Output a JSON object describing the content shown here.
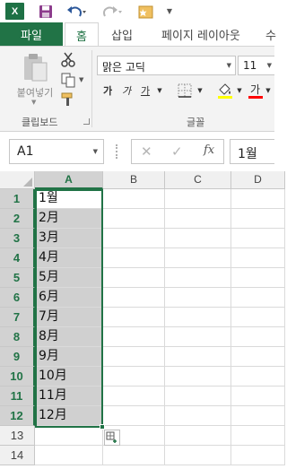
{
  "qat": {
    "excel_letter": "X",
    "icons": [
      "save-icon",
      "undo-icon",
      "redo-icon",
      "app-icon",
      "customize-icon"
    ]
  },
  "tabs": {
    "file": "파일",
    "home": "홈",
    "insert": "삽입",
    "page_layout": "페이지 레이아웃",
    "more": "수"
  },
  "ribbon": {
    "paste_label": "붙여넣기",
    "clipboard_group": "클립보드",
    "font_name": "맑은 고딕",
    "font_size": "11",
    "bold": "가",
    "italic": "가",
    "underline": "가",
    "font_group": "글꼴",
    "colors": {
      "fill": "#ffff00",
      "font": "#ff0000",
      "accent": "#217346"
    }
  },
  "formula_bar": {
    "name_box": "A1",
    "fx": "fx",
    "value": "1월"
  },
  "grid": {
    "columns": [
      "A",
      "B",
      "C",
      "D"
    ],
    "rows": [
      "1",
      "2",
      "3",
      "4",
      "5",
      "6",
      "7",
      "8",
      "9",
      "10",
      "11",
      "12",
      "13",
      "14"
    ],
    "col_a_values": [
      "1월",
      "2月",
      "3月",
      "4月",
      "5月",
      "6月",
      "7月",
      "8月",
      "9月",
      "10月",
      "11月",
      "12月",
      "",
      ""
    ],
    "selected_range": "A1:A12"
  }
}
